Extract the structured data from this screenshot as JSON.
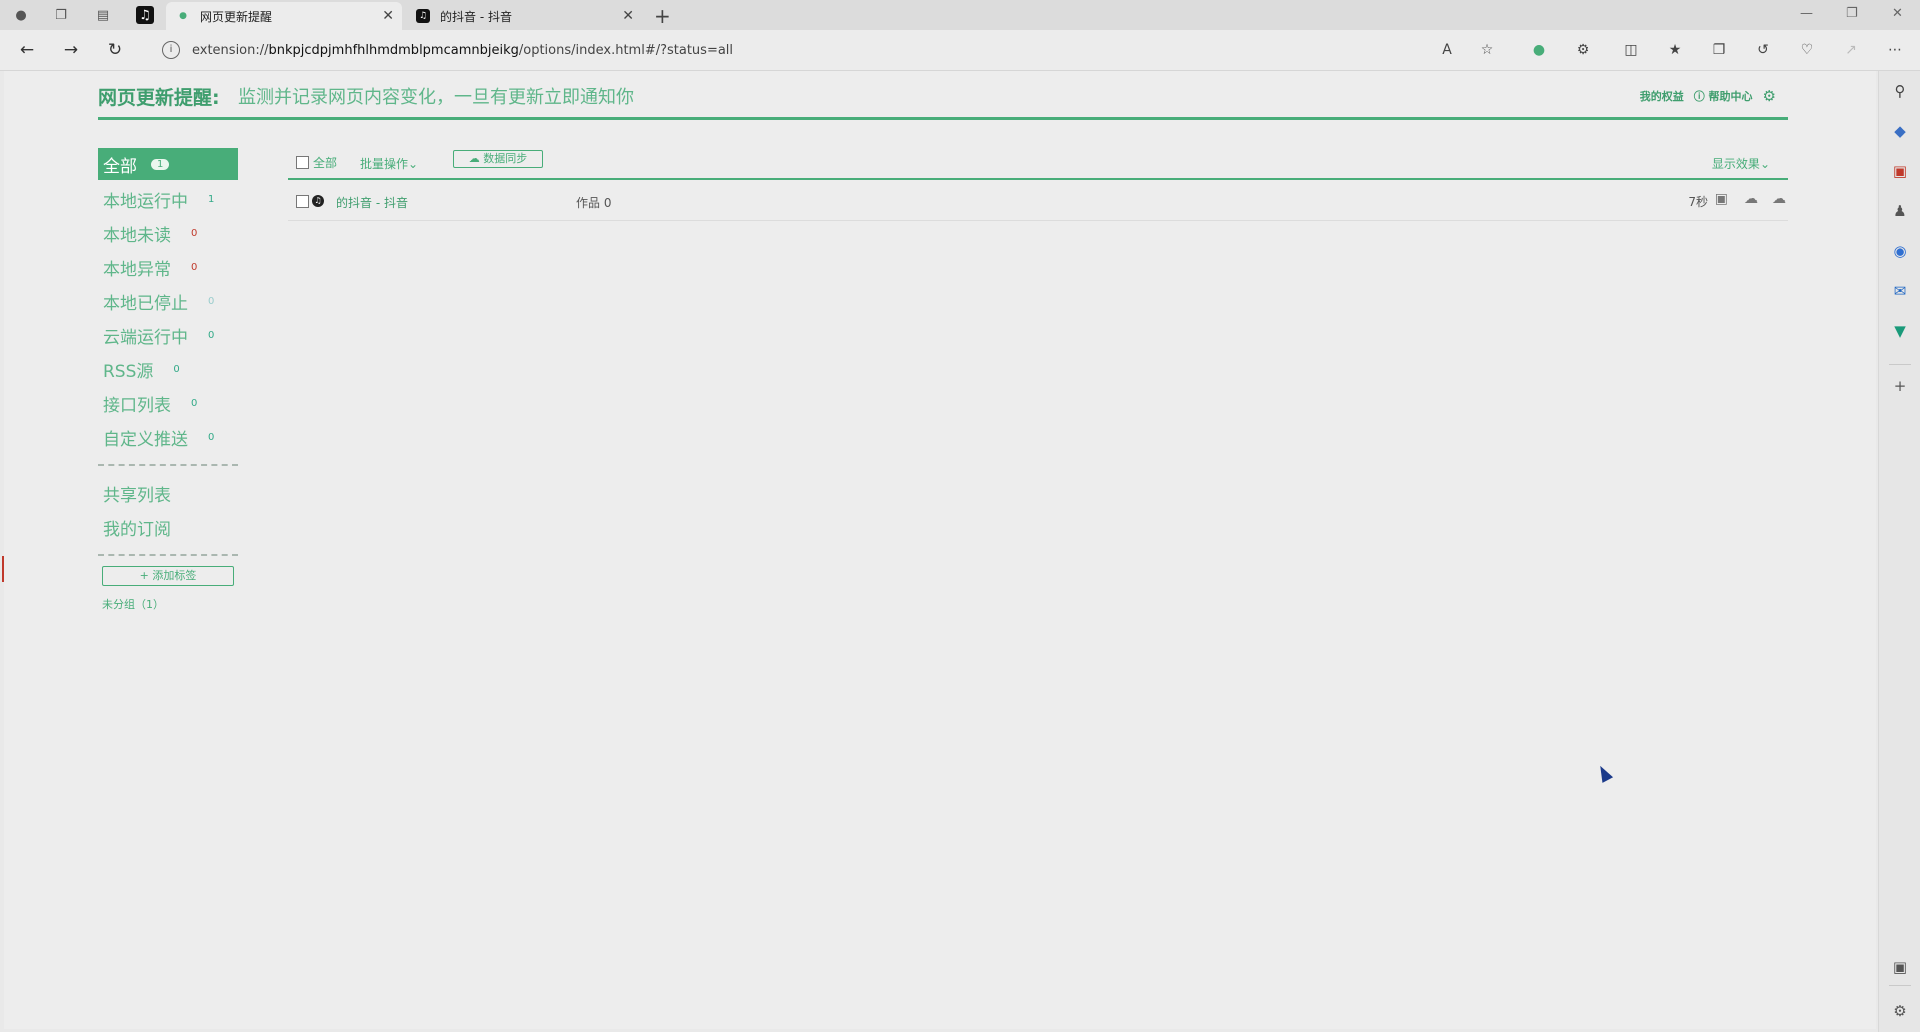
{
  "browser": {
    "tabs": [
      {
        "title": "网页更新提醒",
        "active": true
      },
      {
        "title": "的抖音 - 抖音",
        "active": false
      }
    ],
    "url_prefix": "extension://",
    "url_host": "bnkpjcdpjmhfhlhmdmblpmcamnbjeikg",
    "url_path": "/options/index.html#/?status=all"
  },
  "header": {
    "brand": "网页更新提醒:",
    "slogan": "监测并记录网页内容变化，一旦有更新立即通知你",
    "my_rights": "我的权益",
    "help": "帮助中心"
  },
  "sidebar": {
    "items": [
      {
        "label": "全部",
        "count": "1"
      },
      {
        "label": "本地运行中",
        "count": "1"
      },
      {
        "label": "本地未读",
        "count": "0"
      },
      {
        "label": "本地异常",
        "count": "0"
      },
      {
        "label": "本地已停止",
        "count": "0"
      },
      {
        "label": "云端运行中",
        "count": "0"
      },
      {
        "label": "RSS源",
        "count": "0"
      },
      {
        "label": "接口列表",
        "count": "0"
      },
      {
        "label": "自定义推送",
        "count": "0"
      }
    ],
    "shared": "共享列表",
    "subscriptions": "我的订阅",
    "add_tag": "+ 添加标签",
    "ungrouped": "未分组（1）"
  },
  "main": {
    "select_all": "全部",
    "batch_ops": "批量操作",
    "sync": "数据同步",
    "display": "显示效果",
    "rows": [
      {
        "title": "的抖音 - 抖音",
        "works": "作品 0",
        "interval": "7秒"
      }
    ]
  }
}
